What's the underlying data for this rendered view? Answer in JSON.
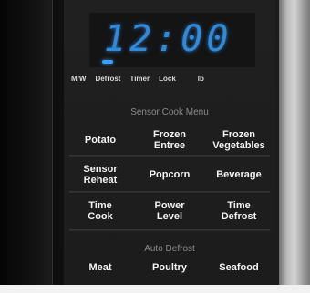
{
  "display": {
    "time_hour": "12",
    "time_minute": "00",
    "status_labels": [
      "M/W",
      "Defrost",
      "Timer",
      "Lock",
      "lb"
    ]
  },
  "sensor_menu": {
    "title": "Sensor Cook Menu",
    "row1": [
      "Potato",
      "Frozen\nEntree",
      "Frozen\nVegetables"
    ],
    "row2": [
      "Sensor\nReheat",
      "Popcorn",
      "Beverage"
    ]
  },
  "control_row": [
    "Time\nCook",
    "Power\nLevel",
    "Time\nDefrost"
  ],
  "auto_defrost": {
    "title": "Auto Defrost",
    "row": [
      "Meat",
      "Poultry",
      "Seafood"
    ]
  },
  "colors": {
    "display_blue": "#2f8ad8",
    "panel_black": "#1c1c1c",
    "label_white": "#f2f2f2",
    "section_gray": "#8a8a8a"
  }
}
